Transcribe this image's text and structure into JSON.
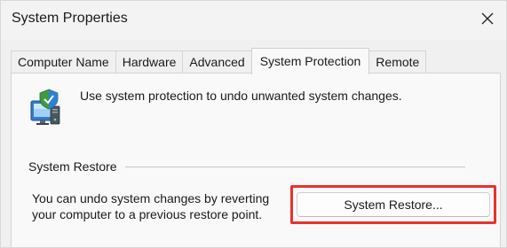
{
  "window": {
    "title": "System Properties"
  },
  "tabs": [
    {
      "label": "Computer Name",
      "active": false
    },
    {
      "label": "Hardware",
      "active": false
    },
    {
      "label": "Advanced",
      "active": false
    },
    {
      "label": "System Protection",
      "active": true
    },
    {
      "label": "Remote",
      "active": false
    }
  ],
  "panel": {
    "intro_text": "Use system protection to undo unwanted system changes.",
    "icon": "system-protection-shield-icon",
    "system_restore": {
      "group_title": "System Restore",
      "description_line1": "You can undo system changes by reverting",
      "description_line2": "your computer to a previous restore point.",
      "button_label": "System Restore..."
    }
  },
  "colors": {
    "highlight": "#e8322c",
    "panel_background": "#f9f9f9",
    "window_background": "#f0f0f0"
  }
}
